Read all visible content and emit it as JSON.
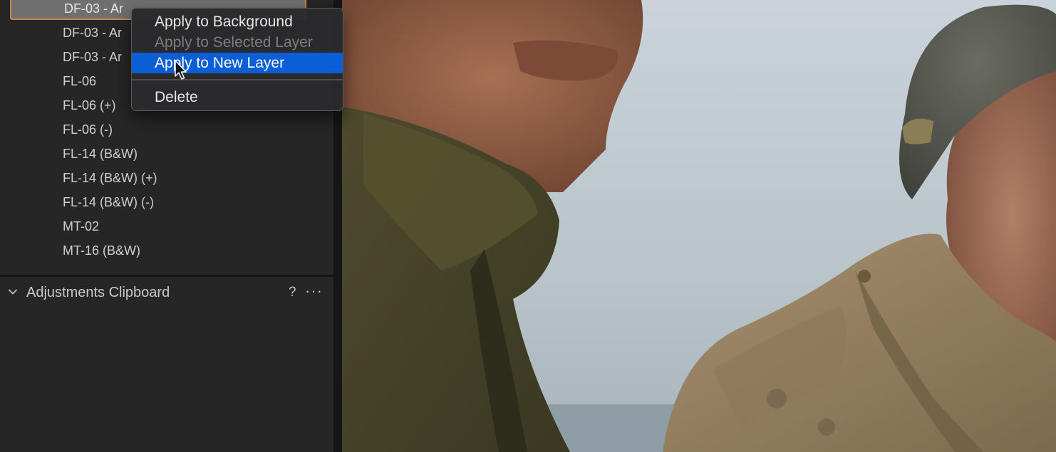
{
  "styles_list": {
    "items": [
      "DF-03 - Ar",
      "DF-03 - Ar",
      "DF-03 - Ar",
      "FL-06",
      "FL-06 (+)",
      "FL-06 (-)",
      "FL-14 (B&W)",
      "FL-14 (B&W) (+)",
      "FL-14 (B&W) (-)",
      "MT-02",
      "MT-16 (B&W)"
    ]
  },
  "adjustments_clipboard": {
    "title": "Adjustments Clipboard",
    "help_label": "?",
    "more_label": "···"
  },
  "context_menu": {
    "items": [
      {
        "label": "Apply to Background",
        "state": "normal"
      },
      {
        "label": "Apply to Selected Layer",
        "state": "disabled"
      },
      {
        "label": "Apply to New Layer",
        "state": "highlighted"
      },
      {
        "label": "Delete",
        "state": "normal"
      }
    ]
  },
  "colors": {
    "panel_bg": "#262626",
    "selection_border": "#c4894f",
    "menu_highlight": "#0a5fd6"
  },
  "icons": [
    "chevron-down-icon",
    "help-icon",
    "more-icon",
    "pointer-cursor-icon"
  ]
}
